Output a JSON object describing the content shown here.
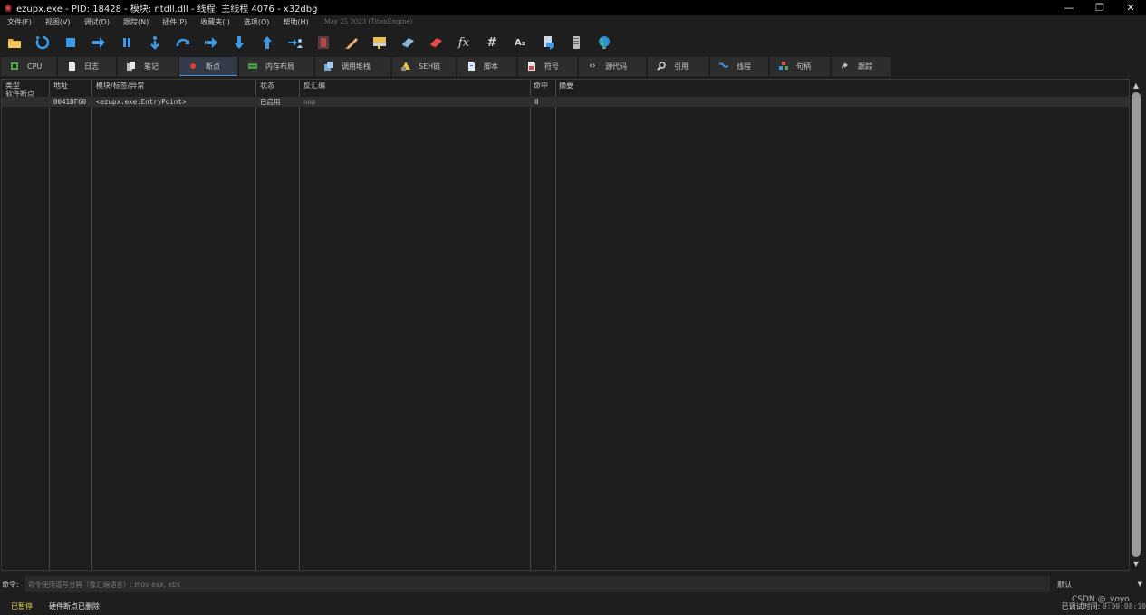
{
  "window": {
    "title": "ezupx.exe - PID: 18428 - 模块: ntdll.dll - 线程: 主线程 4076 - x32dbg",
    "minimize": "—",
    "restore": "❐",
    "close": "✕"
  },
  "menu": {
    "items": [
      "文件(F)",
      "视图(V)",
      "调试(D)",
      "跟踪(N)",
      "插件(P)",
      "收藏夹(I)",
      "选项(O)",
      "帮助(H)"
    ],
    "info": "May 25 2023 (TitanEngine)"
  },
  "toolbar": {
    "icons": [
      "open-icon",
      "restart-icon",
      "stop-icon",
      "run-icon",
      "pause-icon",
      "step-into-icon",
      "step-over-icon",
      "trace-into-icon",
      "trace-over-icon",
      "execute-till-return-icon",
      "run-to-user-code-icon",
      "scylla-icon",
      "patch-icon",
      "comments-icon",
      "labels-icon",
      "bookmarks-icon",
      "functions-icon",
      "variables-icon",
      "strings-icon",
      "calculator-icon",
      "hash-icon",
      "browser-icon"
    ],
    "text_glyphs": {
      "functions": "fx",
      "variables": "#",
      "strings": "A₂"
    }
  },
  "tabs": [
    {
      "label": "CPU",
      "icon": "cpu-icon",
      "active": false
    },
    {
      "label": "日志",
      "icon": "log-icon",
      "active": false
    },
    {
      "label": "笔记",
      "icon": "notes-icon",
      "active": false
    },
    {
      "label": "断点",
      "icon": "breakpoint-icon",
      "active": true
    },
    {
      "label": "内存布局",
      "icon": "memory-map-icon",
      "active": false
    },
    {
      "label": "调用堆栈",
      "icon": "call-stack-icon",
      "active": false
    },
    {
      "label": "SEH链",
      "icon": "seh-icon",
      "active": false
    },
    {
      "label": "脚本",
      "icon": "script-icon",
      "active": false
    },
    {
      "label": "符号",
      "icon": "symbols-icon",
      "active": false
    },
    {
      "label": "源代码",
      "icon": "source-icon",
      "active": false
    },
    {
      "label": "引用",
      "icon": "references-icon",
      "active": false
    },
    {
      "label": "线程",
      "icon": "threads-icon",
      "active": false
    },
    {
      "label": "句柄",
      "icon": "handles-icon",
      "active": false
    },
    {
      "label": "跟踪",
      "icon": "trace-icon",
      "active": false
    }
  ],
  "breakpoints": {
    "columns": [
      "类型",
      "地址",
      "模块/标签/异常",
      "状态",
      "反汇编",
      "命中",
      "摘要"
    ],
    "group": "软件断点",
    "rows": [
      {
        "address": "0041BF60",
        "label": "<ezupx.exe.EntryPoint>",
        "state": "已启用",
        "disasm": "nop",
        "hits": "0",
        "summary": ""
      }
    ]
  },
  "command": {
    "label": "命令:",
    "placeholder": "命令使用逗号分隔（像汇编语言）: mov eax, ebx",
    "mode": "默认"
  },
  "status": {
    "state": "已暂停",
    "message": "硬件断点已删除!",
    "time_label": "已调试时间:",
    "time_value": "0:00:08:10"
  },
  "watermark": "CSDN @_yoyo",
  "colors": {
    "title_bar": "#000000",
    "background": "#1e1e1e",
    "tab": "#2d2d2d",
    "tab_active": "#333a48",
    "status_paused": "#d9d34a",
    "selected_row": "#2f2f2f"
  }
}
